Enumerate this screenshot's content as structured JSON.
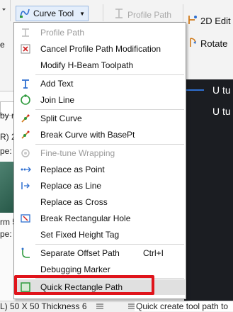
{
  "ribbon": {
    "curve_tool_label": "Curve Tool",
    "profile_path_label": "Profile Path",
    "edit_2d_label": "2D Edit",
    "rotate_label": "Rotate",
    "left_fragment": "e"
  },
  "left_panel": {
    "texts": [
      "by n",
      "R) 2",
      "pe:",
      "rm 5",
      "pe:"
    ]
  },
  "canvas": {
    "lines": [
      "U tu",
      "U tu"
    ]
  },
  "status": {
    "left": "L) 50 X 50 Thickness 6",
    "right": "Quick create tool path to"
  },
  "menu": {
    "items": [
      {
        "label": "Profile Path",
        "icon": "profile-path-icon",
        "disabled": true
      },
      {
        "label": "Cancel Profile Path Modification",
        "icon": "cancel-modification-icon",
        "disabled": false
      },
      {
        "label": "Modify H-Beam Toolpath",
        "icon": "",
        "disabled": false
      },
      {
        "label": "Add Text",
        "icon": "text-icon",
        "disabled": false
      },
      {
        "label": "Join Line",
        "icon": "join-line-icon",
        "disabled": false
      },
      {
        "label": "Split Curve",
        "icon": "split-curve-icon",
        "disabled": false
      },
      {
        "label": "Break Curve with BasePt",
        "icon": "break-curve-icon",
        "disabled": false
      },
      {
        "label": "Fine-tune Wrapping",
        "icon": "fine-tune-icon",
        "disabled": true
      },
      {
        "label": "Replace as Point",
        "icon": "replace-point-icon",
        "disabled": false
      },
      {
        "label": "Replace as Line",
        "icon": "replace-line-icon",
        "disabled": false
      },
      {
        "label": "Replace as Cross",
        "icon": "",
        "disabled": false
      },
      {
        "label": "Break Rectangular Hole",
        "icon": "break-rect-hole-icon",
        "disabled": false
      },
      {
        "label": "Set Fixed Height Tag",
        "icon": "",
        "disabled": false
      },
      {
        "label": "Separate Offset Path",
        "icon": "separate-offset-icon",
        "shortcut": "Ctrl+I",
        "disabled": false
      },
      {
        "label": "Debugging Marker",
        "icon": "",
        "disabled": false
      },
      {
        "label": "Quick Rectangle Path",
        "icon": "quick-rect-path-icon",
        "disabled": false,
        "highlighted": true
      }
    ]
  },
  "colors": {
    "highlight_border": "#e0141b",
    "canvas_bg": "#1b1d22",
    "accent_blue": "#2e6fd0",
    "accent_green": "#2d9a3c"
  }
}
